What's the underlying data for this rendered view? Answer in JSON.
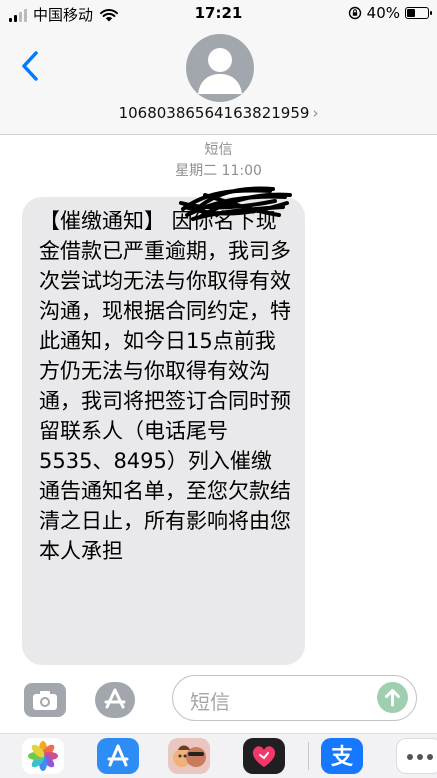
{
  "status_bar": {
    "carrier": "中国移动",
    "time": "17:21",
    "battery": "40%",
    "battery_level": 0.4
  },
  "header": {
    "contact_number": "10680386564163821959",
    "chevron": "›"
  },
  "conversation": {
    "service_label": "短信",
    "timestamp": "星期二 11:00",
    "message": "【催缴通知】 因你名下现金借款已严重逾期，我司多次尝试均无法与你取得有效沟通，现根据合同约定，特此通知，如今日15点前我方仍无法与你取得有效沟通，我司将把签订合同时预留联系人（电话尾号5535、8495）列入催缴通告通知名单，至您欠款结清之日止，所有影响将由您本人承担"
  },
  "input_bar": {
    "placeholder": "短信"
  },
  "app_drawer": {
    "apps": [
      "photos-icon",
      "app-store-icon",
      "memoji-icon",
      "digital-touch-icon",
      "alipay-icon",
      "more-apps-icon"
    ],
    "alipay_glyph": "支"
  },
  "colors": {
    "accent": "#007aff",
    "bubble_gray": "#e9e9eb",
    "send_green": "#9fcfb0"
  }
}
